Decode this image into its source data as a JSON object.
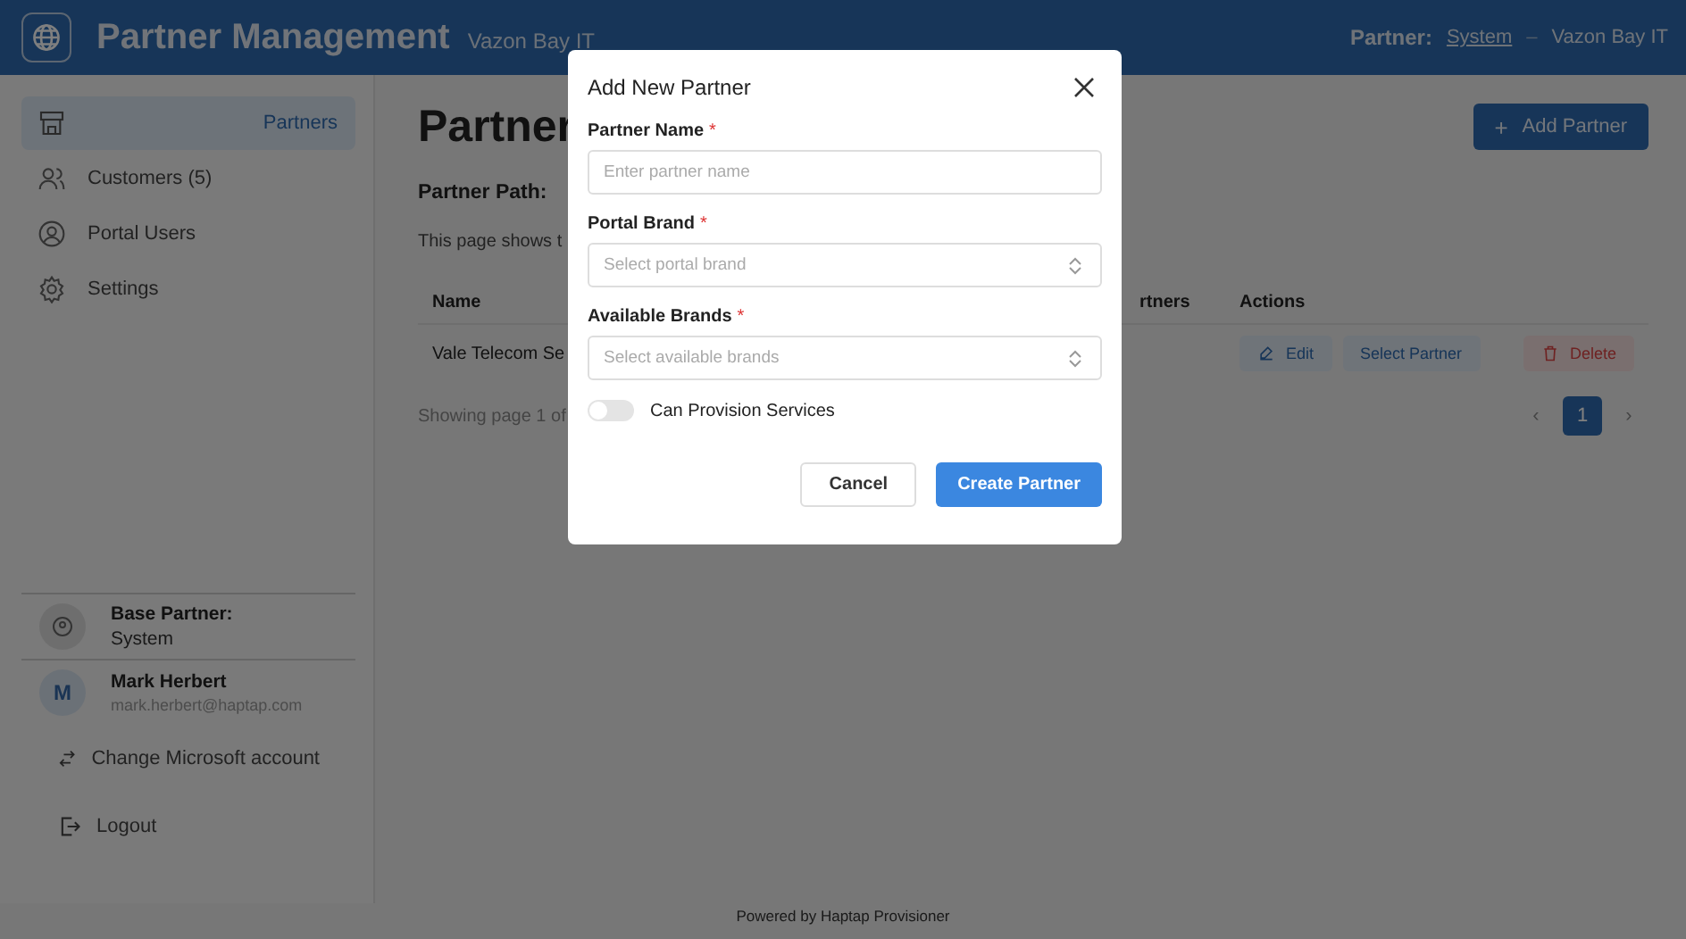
{
  "header": {
    "title": "Partner Management",
    "subtitle": "Vazon Bay IT",
    "partner_label": "Partner:",
    "partner_link": "System",
    "separator": "–",
    "current_partner": "Vazon Bay IT"
  },
  "sidebar": {
    "items": [
      {
        "label": "Partners",
        "selected": true
      },
      {
        "label": "Customers (5)",
        "selected": false
      },
      {
        "label": "Portal Users",
        "selected": false
      },
      {
        "label": "Settings",
        "selected": false
      }
    ],
    "base_partner": {
      "label": "Base Partner:",
      "value": "System"
    },
    "user": {
      "initial": "M",
      "name": "Mark Herbert",
      "email": "mark.herbert@haptap.com"
    },
    "actions": [
      "Change Microsoft account",
      "Logout"
    ]
  },
  "main": {
    "title": "Partner",
    "path_label": "Partner Path:",
    "description": "This page shows t",
    "add_button": {
      "icon": "+",
      "label": "Add Partner"
    },
    "table": {
      "columns": [
        "Name",
        "rtners",
        "Actions"
      ],
      "rows": [
        {
          "name": "Vale Telecom Se",
          "actions": [
            "Edit",
            "Select Partner",
            "Delete"
          ]
        }
      ]
    },
    "page_info": "Showing page 1 of",
    "pagination": [
      {
        "label": "‹",
        "selected": false
      },
      {
        "label": "1",
        "selected": true
      },
      {
        "label": "›",
        "selected": false
      }
    ]
  },
  "footer": "Powered by Haptap Provisioner",
  "dialog": {
    "title": "Add New Partner",
    "fields": [
      {
        "label": "Partner Name",
        "required_mark": "*",
        "kind": "input",
        "placeholder": "Enter partner name"
      },
      {
        "label": "Portal Brand",
        "required_mark": "*",
        "kind": "select",
        "placeholder": "Select portal brand"
      },
      {
        "label": "Available Brands",
        "required_mark": "*",
        "kind": "select",
        "placeholder": "Select available brands"
      }
    ],
    "toggle": {
      "label": "Can Provision Services",
      "on": false
    },
    "buttons": [
      {
        "label": "Cancel",
        "kind": "secondary"
      },
      {
        "label": "Create Partner",
        "kind": "primary"
      }
    ]
  }
}
